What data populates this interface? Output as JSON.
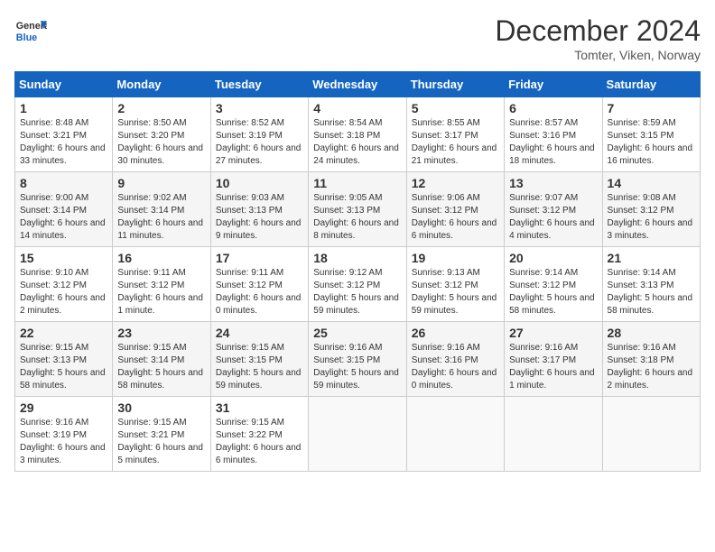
{
  "header": {
    "logo_general": "General",
    "logo_blue": "Blue",
    "month": "December 2024",
    "location": "Tomter, Viken, Norway"
  },
  "weekdays": [
    "Sunday",
    "Monday",
    "Tuesday",
    "Wednesday",
    "Thursday",
    "Friday",
    "Saturday"
  ],
  "weeks": [
    [
      {
        "day": "1",
        "sunrise": "Sunrise: 8:48 AM",
        "sunset": "Sunset: 3:21 PM",
        "daylight": "Daylight: 6 hours and 33 minutes."
      },
      {
        "day": "2",
        "sunrise": "Sunrise: 8:50 AM",
        "sunset": "Sunset: 3:20 PM",
        "daylight": "Daylight: 6 hours and 30 minutes."
      },
      {
        "day": "3",
        "sunrise": "Sunrise: 8:52 AM",
        "sunset": "Sunset: 3:19 PM",
        "daylight": "Daylight: 6 hours and 27 minutes."
      },
      {
        "day": "4",
        "sunrise": "Sunrise: 8:54 AM",
        "sunset": "Sunset: 3:18 PM",
        "daylight": "Daylight: 6 hours and 24 minutes."
      },
      {
        "day": "5",
        "sunrise": "Sunrise: 8:55 AM",
        "sunset": "Sunset: 3:17 PM",
        "daylight": "Daylight: 6 hours and 21 minutes."
      },
      {
        "day": "6",
        "sunrise": "Sunrise: 8:57 AM",
        "sunset": "Sunset: 3:16 PM",
        "daylight": "Daylight: 6 hours and 18 minutes."
      },
      {
        "day": "7",
        "sunrise": "Sunrise: 8:59 AM",
        "sunset": "Sunset: 3:15 PM",
        "daylight": "Daylight: 6 hours and 16 minutes."
      }
    ],
    [
      {
        "day": "8",
        "sunrise": "Sunrise: 9:00 AM",
        "sunset": "Sunset: 3:14 PM",
        "daylight": "Daylight: 6 hours and 14 minutes."
      },
      {
        "day": "9",
        "sunrise": "Sunrise: 9:02 AM",
        "sunset": "Sunset: 3:14 PM",
        "daylight": "Daylight: 6 hours and 11 minutes."
      },
      {
        "day": "10",
        "sunrise": "Sunrise: 9:03 AM",
        "sunset": "Sunset: 3:13 PM",
        "daylight": "Daylight: 6 hours and 9 minutes."
      },
      {
        "day": "11",
        "sunrise": "Sunrise: 9:05 AM",
        "sunset": "Sunset: 3:13 PM",
        "daylight": "Daylight: 6 hours and 8 minutes."
      },
      {
        "day": "12",
        "sunrise": "Sunrise: 9:06 AM",
        "sunset": "Sunset: 3:12 PM",
        "daylight": "Daylight: 6 hours and 6 minutes."
      },
      {
        "day": "13",
        "sunrise": "Sunrise: 9:07 AM",
        "sunset": "Sunset: 3:12 PM",
        "daylight": "Daylight: 6 hours and 4 minutes."
      },
      {
        "day": "14",
        "sunrise": "Sunrise: 9:08 AM",
        "sunset": "Sunset: 3:12 PM",
        "daylight": "Daylight: 6 hours and 3 minutes."
      }
    ],
    [
      {
        "day": "15",
        "sunrise": "Sunrise: 9:10 AM",
        "sunset": "Sunset: 3:12 PM",
        "daylight": "Daylight: 6 hours and 2 minutes."
      },
      {
        "day": "16",
        "sunrise": "Sunrise: 9:11 AM",
        "sunset": "Sunset: 3:12 PM",
        "daylight": "Daylight: 6 hours and 1 minute."
      },
      {
        "day": "17",
        "sunrise": "Sunrise: 9:11 AM",
        "sunset": "Sunset: 3:12 PM",
        "daylight": "Daylight: 6 hours and 0 minutes."
      },
      {
        "day": "18",
        "sunrise": "Sunrise: 9:12 AM",
        "sunset": "Sunset: 3:12 PM",
        "daylight": "Daylight: 5 hours and 59 minutes."
      },
      {
        "day": "19",
        "sunrise": "Sunrise: 9:13 AM",
        "sunset": "Sunset: 3:12 PM",
        "daylight": "Daylight: 5 hours and 59 minutes."
      },
      {
        "day": "20",
        "sunrise": "Sunrise: 9:14 AM",
        "sunset": "Sunset: 3:12 PM",
        "daylight": "Daylight: 5 hours and 58 minutes."
      },
      {
        "day": "21",
        "sunrise": "Sunrise: 9:14 AM",
        "sunset": "Sunset: 3:13 PM",
        "daylight": "Daylight: 5 hours and 58 minutes."
      }
    ],
    [
      {
        "day": "22",
        "sunrise": "Sunrise: 9:15 AM",
        "sunset": "Sunset: 3:13 PM",
        "daylight": "Daylight: 5 hours and 58 minutes."
      },
      {
        "day": "23",
        "sunrise": "Sunrise: 9:15 AM",
        "sunset": "Sunset: 3:14 PM",
        "daylight": "Daylight: 5 hours and 58 minutes."
      },
      {
        "day": "24",
        "sunrise": "Sunrise: 9:15 AM",
        "sunset": "Sunset: 3:15 PM",
        "daylight": "Daylight: 5 hours and 59 minutes."
      },
      {
        "day": "25",
        "sunrise": "Sunrise: 9:16 AM",
        "sunset": "Sunset: 3:15 PM",
        "daylight": "Daylight: 5 hours and 59 minutes."
      },
      {
        "day": "26",
        "sunrise": "Sunrise: 9:16 AM",
        "sunset": "Sunset: 3:16 PM",
        "daylight": "Daylight: 6 hours and 0 minutes."
      },
      {
        "day": "27",
        "sunrise": "Sunrise: 9:16 AM",
        "sunset": "Sunset: 3:17 PM",
        "daylight": "Daylight: 6 hours and 1 minute."
      },
      {
        "day": "28",
        "sunrise": "Sunrise: 9:16 AM",
        "sunset": "Sunset: 3:18 PM",
        "daylight": "Daylight: 6 hours and 2 minutes."
      }
    ],
    [
      {
        "day": "29",
        "sunrise": "Sunrise: 9:16 AM",
        "sunset": "Sunset: 3:19 PM",
        "daylight": "Daylight: 6 hours and 3 minutes."
      },
      {
        "day": "30",
        "sunrise": "Sunrise: 9:15 AM",
        "sunset": "Sunset: 3:21 PM",
        "daylight": "Daylight: 6 hours and 5 minutes."
      },
      {
        "day": "31",
        "sunrise": "Sunrise: 9:15 AM",
        "sunset": "Sunset: 3:22 PM",
        "daylight": "Daylight: 6 hours and 6 minutes."
      },
      null,
      null,
      null,
      null
    ]
  ]
}
